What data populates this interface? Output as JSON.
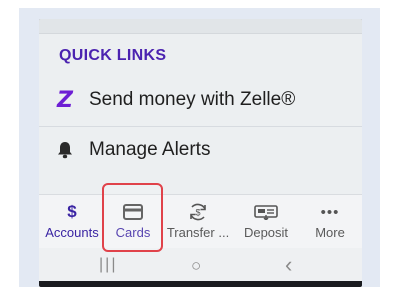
{
  "quick_links": {
    "title": "QUICK LINKS",
    "items": [
      {
        "icon": "zelle-z-icon",
        "label": "Send money with Zelle®"
      },
      {
        "icon": "bell-icon",
        "label": "Manage Alerts"
      }
    ]
  },
  "bottom_nav": {
    "items": [
      {
        "label": "Accounts",
        "icon": "dollar-icon",
        "glyph": "$"
      },
      {
        "label": "Cards",
        "icon": "card-icon"
      },
      {
        "label": "Transfer ...",
        "icon": "transfer-icon"
      },
      {
        "label": "Deposit",
        "icon": "check-deposit-icon"
      },
      {
        "label": "More",
        "icon": "more-dots-icon",
        "glyph": "•••"
      }
    ],
    "selected": "Cards",
    "accent": "#3a24a3"
  },
  "highlight_color": "#e0424a",
  "system_nav": {
    "recent": "|||",
    "home": "○",
    "back": "‹"
  }
}
